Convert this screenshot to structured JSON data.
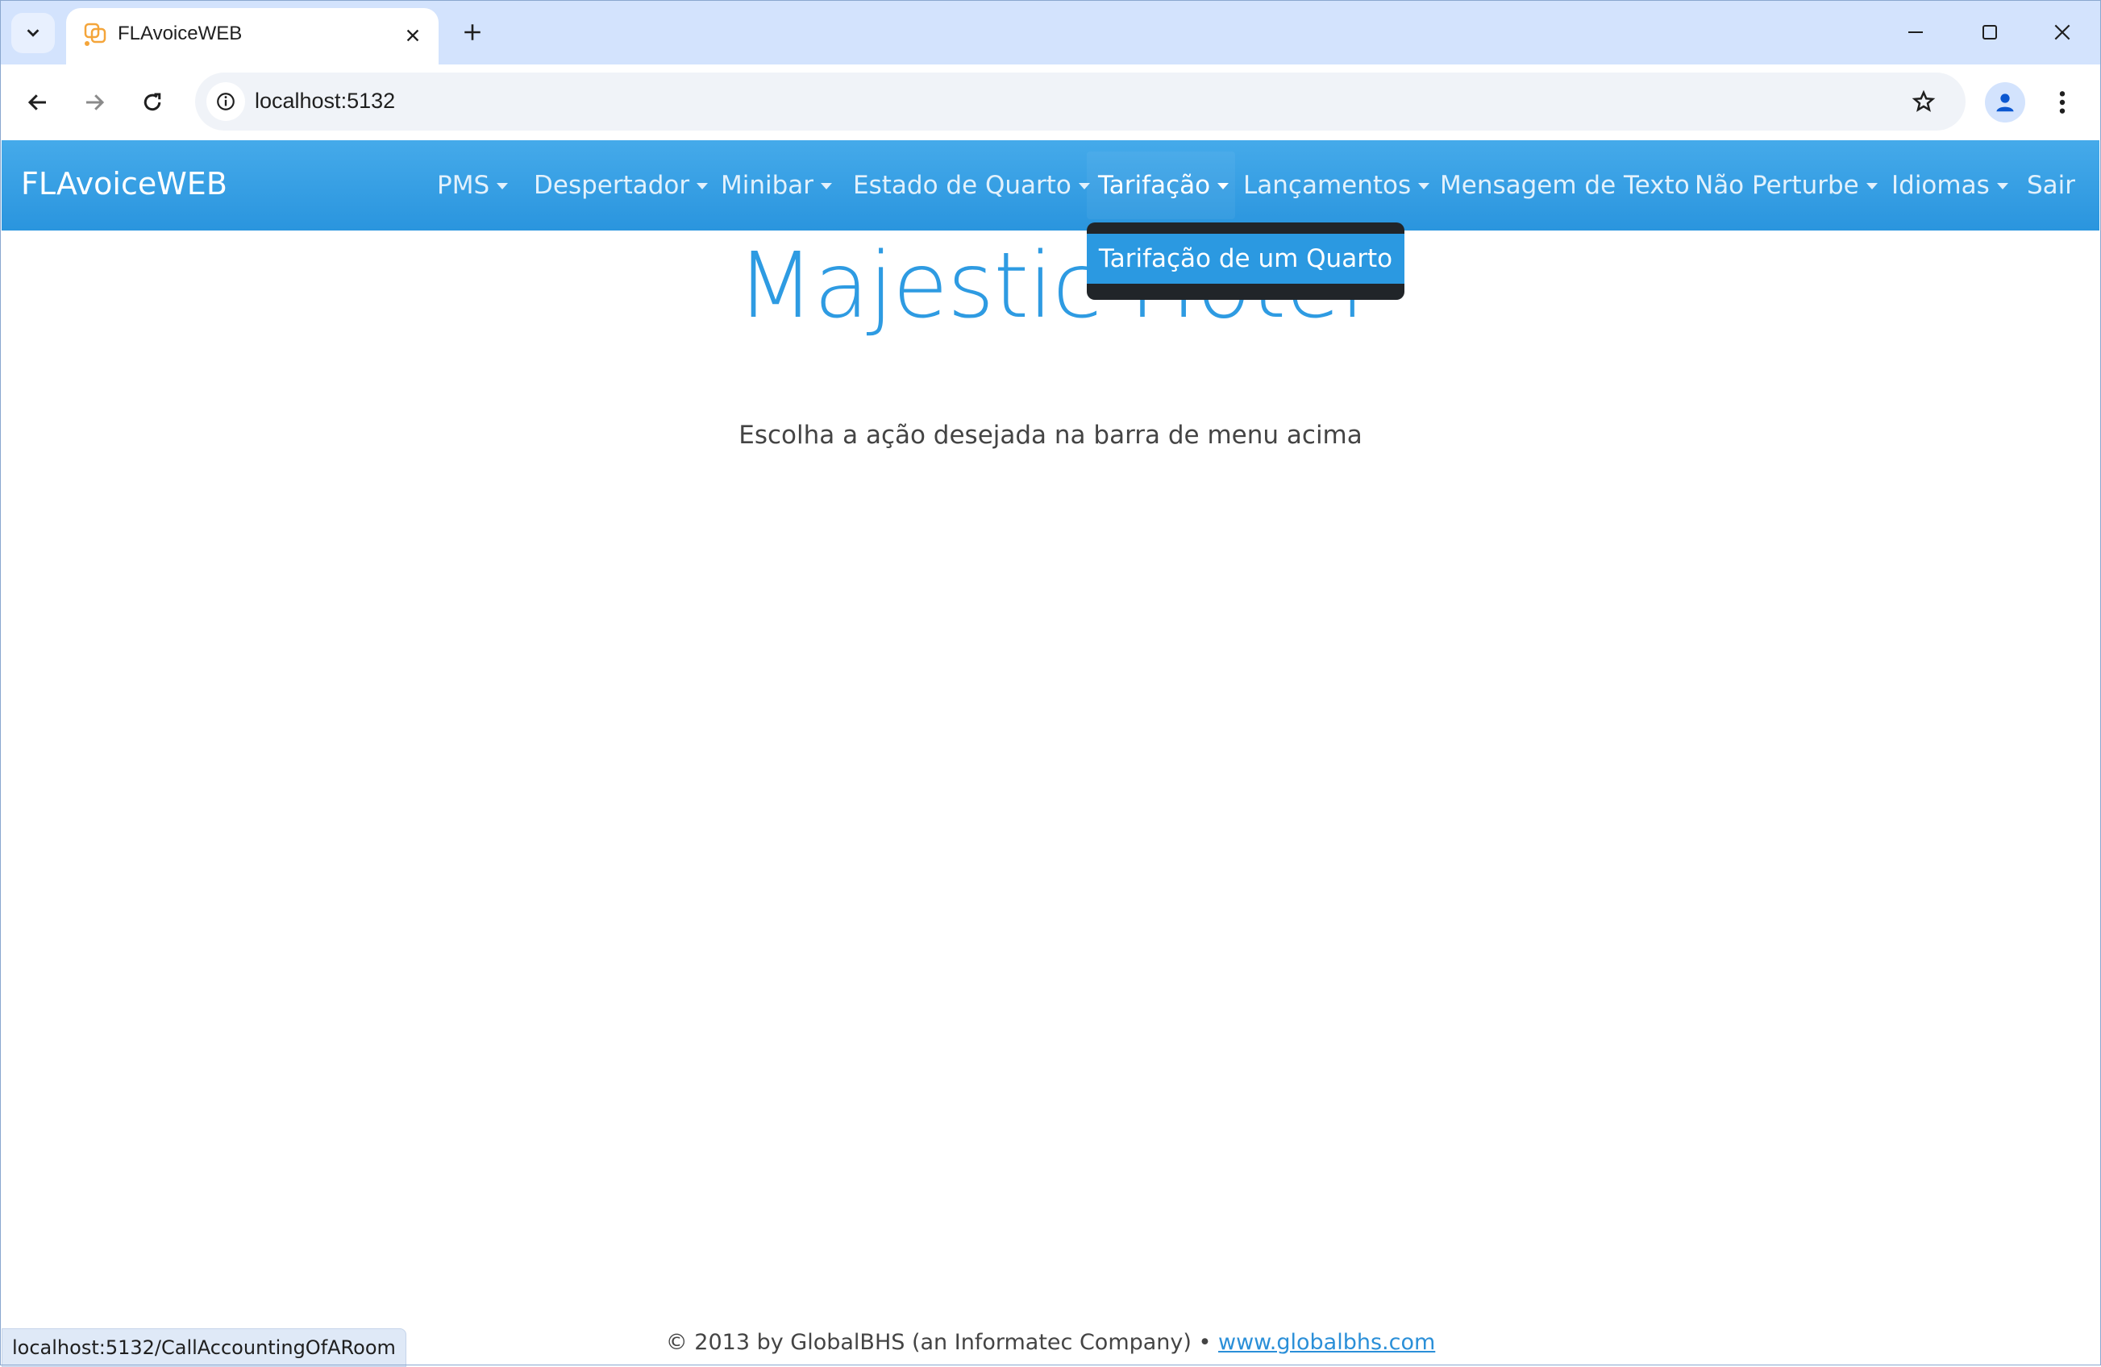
{
  "browser": {
    "tab_title": "FLAvoiceWEB",
    "url": "localhost:5132",
    "status_url": "localhost:5132/CallAccountingOfARoom"
  },
  "navbar": {
    "brand": "FLAvoiceWEB",
    "items": [
      {
        "label": "PMS",
        "dropdown": true
      },
      {
        "label": "Despertador",
        "dropdown": true
      },
      {
        "label": "Minibar",
        "dropdown": true
      },
      {
        "label": "Estado de Quarto",
        "dropdown": true
      },
      {
        "label": "Tarifação",
        "dropdown": true,
        "active": true
      },
      {
        "label": "Lançamentos",
        "dropdown": true
      },
      {
        "label": "Mensagem de Texto",
        "dropdown": false
      },
      {
        "label": "Não Perturbe",
        "dropdown": true
      },
      {
        "label": "Idiomas",
        "dropdown": true
      },
      {
        "label": "Sair",
        "dropdown": false
      }
    ]
  },
  "dropdown": {
    "items": [
      "Tarifação de um Quarto"
    ]
  },
  "main": {
    "title": "Majestic Hotel",
    "subtitle": "Escolha a ação desejada na barra de menu acima"
  },
  "footer": {
    "text": "© 2013 by GlobalBHS (an Informatec Company) • ",
    "link": "www.globalbhs.com"
  },
  "colors": {
    "navbar": "#2a95de",
    "title": "#2e9be2",
    "dropdown_bg": "#212529",
    "dropdown_item": "#2b99e1"
  }
}
